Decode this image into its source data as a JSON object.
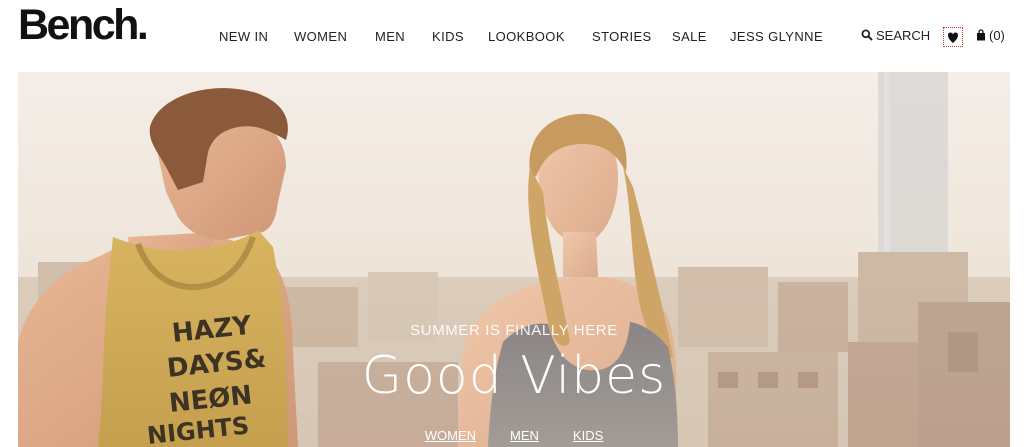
{
  "brand": {
    "logo_text": "Bench."
  },
  "nav": {
    "items": [
      {
        "label": "NEW IN"
      },
      {
        "label": "WOMEN"
      },
      {
        "label": "MEN"
      },
      {
        "label": "KIDS"
      },
      {
        "label": "LOOKBOOK"
      },
      {
        "label": "STORIES"
      },
      {
        "label": "SALE"
      },
      {
        "label": "JESS GLYNNE"
      }
    ]
  },
  "utility": {
    "search_label": "SEARCH",
    "search_icon": "search-icon",
    "wishlist_icon": "heart-icon",
    "bag_icon": "bag-icon",
    "bag_count": "(0)"
  },
  "hero": {
    "subtitle": "SUMMER IS FINALLY HERE",
    "title": "Good Vibes",
    "shirt_text": [
      "HAZY",
      "DAYS&",
      "NEØN",
      "NIGHTS"
    ],
    "links": [
      {
        "label": "WOMEN"
      },
      {
        "label": "MEN"
      },
      {
        "label": "KIDS"
      }
    ]
  }
}
